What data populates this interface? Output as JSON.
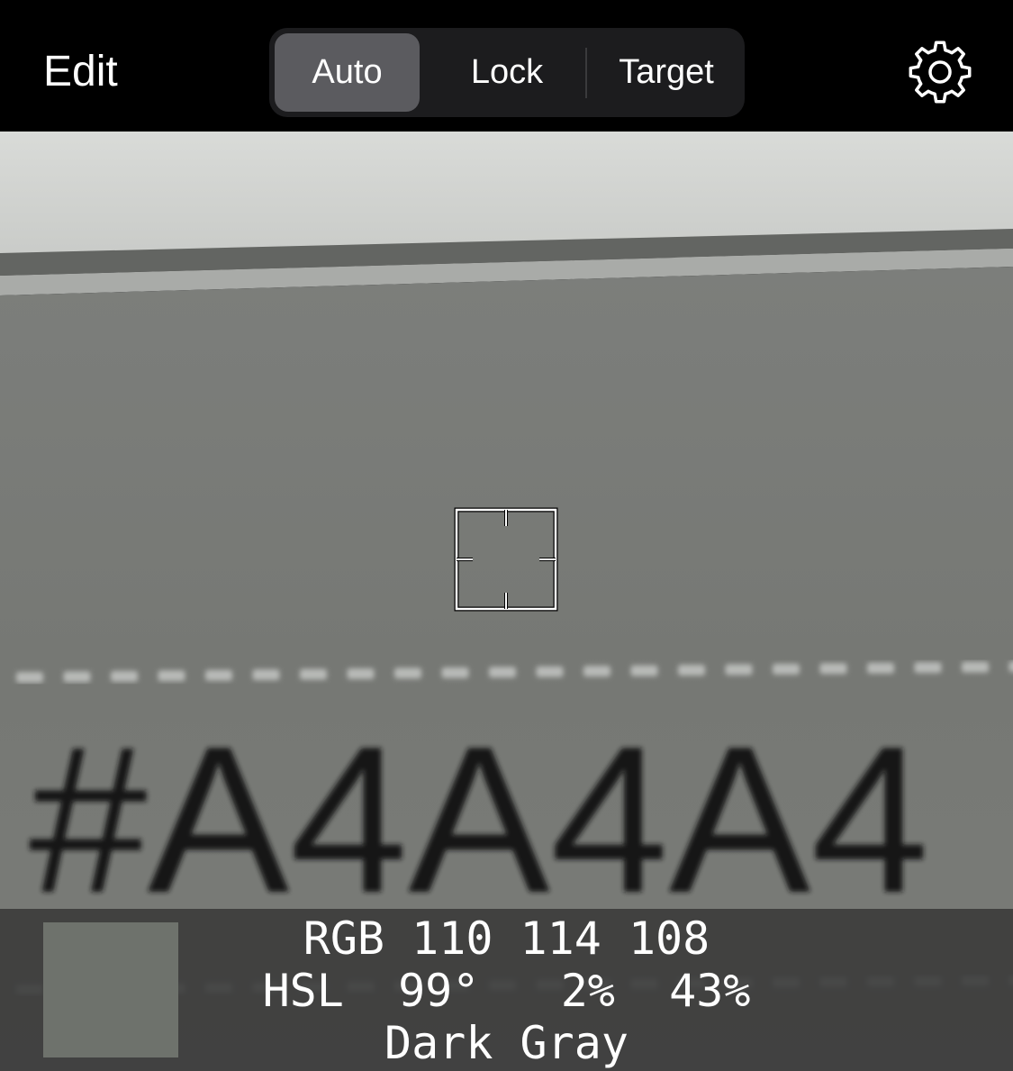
{
  "topbar": {
    "edit_label": "Edit",
    "modes": [
      {
        "label": "Auto",
        "selected": true
      },
      {
        "label": "Lock",
        "selected": false
      },
      {
        "label": "Target",
        "selected": false
      }
    ],
    "settings_icon": "gear-icon"
  },
  "camera": {
    "visible_text": "#A4A4A4",
    "reticle_icon": "crosshair-reticle-icon"
  },
  "info": {
    "swatch_color": "#6e726c",
    "rgb_line": "RGB 110 114 108",
    "hsl_line": "HSL  99°   2%  43%",
    "color_name": "Dark Gray"
  },
  "colors": {
    "bar_background": "#000000",
    "segment_background": "#1c1c1e",
    "segment_selected": "#5b5b5f",
    "panel_background": "#343434"
  }
}
